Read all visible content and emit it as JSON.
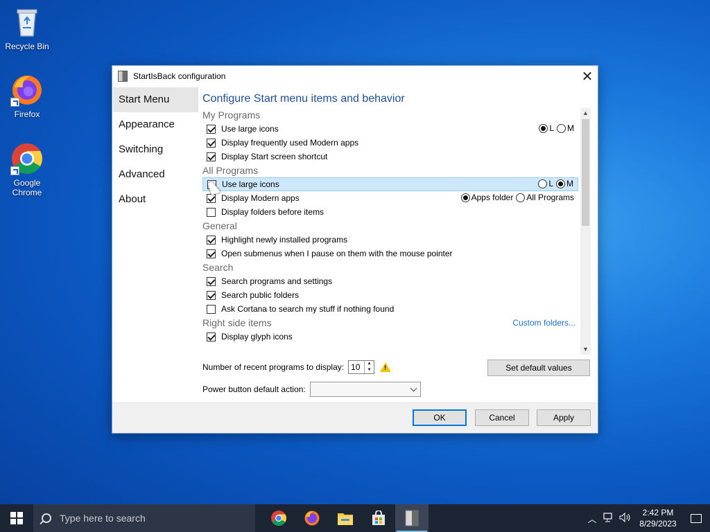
{
  "desktop": {
    "icons": [
      {
        "label": "Recycle Bin"
      },
      {
        "label": "Firefox"
      },
      {
        "label": "Google Chrome"
      }
    ]
  },
  "dialog": {
    "title": "StartIsBack configuration",
    "nav": [
      "Start Menu",
      "Appearance",
      "Switching",
      "Advanced",
      "About"
    ],
    "heading": "Configure Start menu items and behavior",
    "sections": {
      "my_programs": {
        "label": "My Programs",
        "items": [
          {
            "label": "Use large icons",
            "checked": true
          },
          {
            "label": "Display frequently used Modern apps",
            "checked": true
          },
          {
            "label": "Display Start screen shortcut",
            "checked": true
          }
        ],
        "size_opts": [
          "L",
          "M"
        ]
      },
      "all_programs": {
        "label": "All Programs",
        "items": [
          {
            "label": "Use large icons",
            "checked": false
          },
          {
            "label": "Display Modern apps",
            "checked": true
          },
          {
            "label": "Display folders before items",
            "checked": false
          }
        ],
        "size_opts": [
          "L",
          "M"
        ],
        "modern_opts": [
          "Apps folder",
          "All Programs"
        ]
      },
      "general": {
        "label": "General",
        "items": [
          {
            "label": "Highlight newly installed programs",
            "checked": true
          },
          {
            "label": "Open submenus when I pause on them with the mouse pointer",
            "checked": true
          }
        ]
      },
      "search": {
        "label": "Search",
        "items": [
          {
            "label": "Search programs and settings",
            "checked": true
          },
          {
            "label": "Search public folders",
            "checked": true
          },
          {
            "label": "Ask Cortana to search my stuff if nothing found",
            "checked": false
          }
        ]
      },
      "right_side": {
        "label": "Right side items",
        "link": "Custom folders...",
        "items": [
          {
            "label": "Display glyph icons",
            "checked": true
          }
        ]
      }
    },
    "recent_label": "Number of recent programs to display:",
    "recent_value": "10",
    "default_button": "Set default values",
    "power_label": "Power button default action:",
    "buttons": {
      "ok": "OK",
      "cancel": "Cancel",
      "apply": "Apply"
    }
  },
  "taskbar": {
    "search_placeholder": "Type here to search",
    "time": "2:42 PM",
    "date": "8/29/2023"
  }
}
